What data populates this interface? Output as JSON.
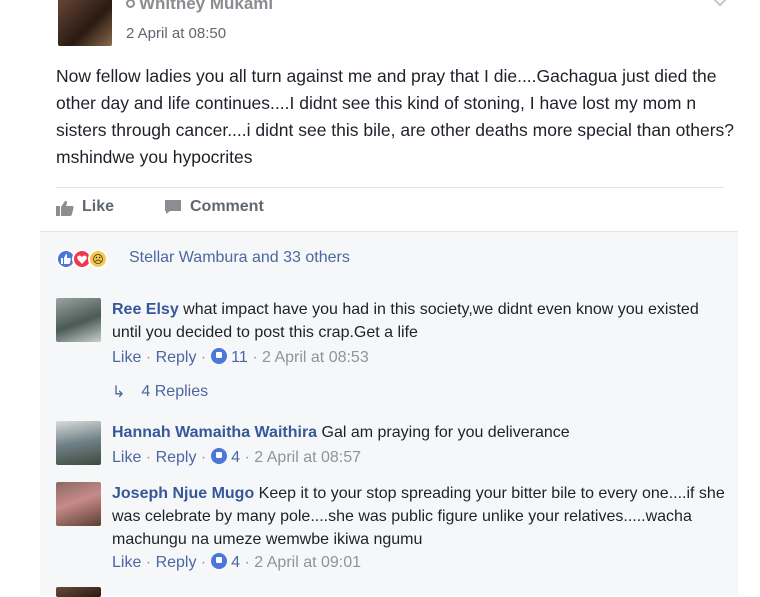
{
  "post": {
    "author": "Whitney Mukami",
    "time": "2 April at 08:50",
    "text": "Now fellow ladies you all turn against me and pray that I die....Gachagua just died the other day and life continues....I didnt see this kind of stoning, I have lost my mom n sisters through cancer....i didnt see this bile, are other deaths more special than others? mshindwe you hypocrites",
    "actions": {
      "like": "Like",
      "comment": "Comment"
    },
    "reactions": {
      "summary": "Stellar Wambura and 33 others",
      "icons": [
        "like-reaction",
        "love-reaction",
        "sad-reaction"
      ]
    }
  },
  "comments": [
    {
      "name": "Ree Elsy",
      "text": " what impact have you had in this society,we didnt even know you existed until you decided to post this crap.Get a life",
      "like": "Like",
      "reply": "Reply",
      "likes": "11",
      "time": "2 April at 08:53",
      "replies": "4 Replies"
    },
    {
      "name": "Hannah Wamaitha Waithira",
      "text": " Gal am praying for you deliverance",
      "like": "Like",
      "reply": "Reply",
      "likes": "4",
      "time": "2 April at 08:57"
    },
    {
      "name": "Joseph Njue Mugo",
      "text": " Keep it to your stop spreading your bitter bile to every one....if she was celebrate by many pole....she was public figure unlike your relatives.....wacha machungu na umeze wemwbe ikiwa ngumu",
      "like": "Like",
      "reply": "Reply",
      "likes": "4",
      "time": "2 April at 09:01"
    }
  ],
  "colors": {
    "link": "#365899",
    "meta": "#8d949e",
    "accent": "#4a77d8"
  }
}
